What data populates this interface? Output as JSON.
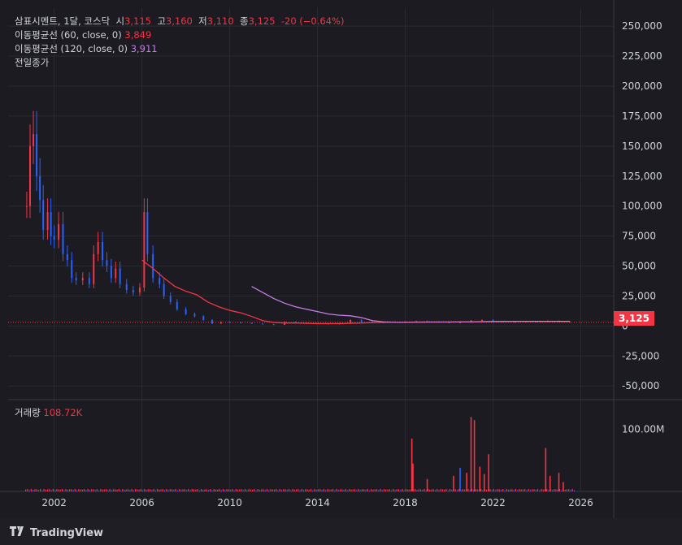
{
  "legend": {
    "symbol": "삼표시멘트, 1달, 코스닥",
    "open_label": "시",
    "open": "3,115",
    "high_label": "고",
    "high": "3,160",
    "low_label": "저",
    "low": "3,110",
    "close_label": "종",
    "close": "3,125",
    "change": "-20 (−0.64%)",
    "ma60_label": "이동평균선 (60, close, 0)",
    "ma60_value": "3,849",
    "ma120_label": "이동평균선 (120, close, 0)",
    "ma120_value": "3,911",
    "prev_close_label": "전일종가",
    "volume_label": "거래량",
    "volume_value": "108.72K"
  },
  "price_tag": "3,125",
  "footer": {
    "brand": "TradingView"
  },
  "colors": {
    "up": "#f23645",
    "down": "#2962ff",
    "ma60": "#f23645",
    "ma120": "#c77de6",
    "background": "#1b1b21",
    "grid": "#2a2a31"
  },
  "chart_data": {
    "type": "candlestick",
    "interval": "1 month",
    "y_ticks": [
      "250,000",
      "225,000",
      "200,000",
      "175,000",
      "150,000",
      "125,000",
      "100,000",
      "75,000",
      "50,000",
      "25,000",
      "0",
      "-25,000",
      "-50,000"
    ],
    "y_tick_values": [
      250000,
      225000,
      200000,
      175000,
      150000,
      125000,
      100000,
      75000,
      50000,
      25000,
      0,
      -25000,
      -50000
    ],
    "ylim": [
      -60000,
      265000
    ],
    "x_ticks": [
      "2002",
      "2006",
      "2010",
      "2014",
      "2018",
      "2022",
      "2026"
    ],
    "x_tick_values": [
      2002,
      2006,
      2010,
      2014,
      2018,
      2022,
      2026
    ],
    "xlim": [
      1999.9,
      2027.5
    ],
    "volume_ticks": [
      "100.00M"
    ],
    "volume_tick_values": [
      100000000
    ],
    "volume_max": 135000000,
    "last_price": 3125,
    "price_series": [
      [
        2000.75,
        100000
      ],
      [
        2000.9,
        150000
      ],
      [
        2001.05,
        160000
      ],
      [
        2001.2,
        125000
      ],
      [
        2001.35,
        105000
      ],
      [
        2001.5,
        80000
      ],
      [
        2001.7,
        95000
      ],
      [
        2001.85,
        75000
      ],
      [
        2002.0,
        72000
      ],
      [
        2002.2,
        85000
      ],
      [
        2002.4,
        60000
      ],
      [
        2002.6,
        55000
      ],
      [
        2002.8,
        40000
      ],
      [
        2003.0,
        38000
      ],
      [
        2003.3,
        40000
      ],
      [
        2003.6,
        35000
      ],
      [
        2003.8,
        60000
      ],
      [
        2004.0,
        70000
      ],
      [
        2004.2,
        55000
      ],
      [
        2004.4,
        50000
      ],
      [
        2004.6,
        40000
      ],
      [
        2004.8,
        48000
      ],
      [
        2005.0,
        35000
      ],
      [
        2005.3,
        30000
      ],
      [
        2005.6,
        28000
      ],
      [
        2005.9,
        32000
      ],
      [
        2006.1,
        95000
      ],
      [
        2006.25,
        60000
      ],
      [
        2006.5,
        40000
      ],
      [
        2006.8,
        35000
      ],
      [
        2007.0,
        25000
      ],
      [
        2007.3,
        20000
      ],
      [
        2007.6,
        14000
      ],
      [
        2008.0,
        10000
      ],
      [
        2008.4,
        8000
      ],
      [
        2008.8,
        5000
      ],
      [
        2009.2,
        2000
      ],
      [
        2009.6,
        3500
      ],
      [
        2010.0,
        3000
      ],
      [
        2010.5,
        2500
      ],
      [
        2011.0,
        2000
      ],
      [
        2011.5,
        1500
      ],
      [
        2012.0,
        1000
      ],
      [
        2012.5,
        3500
      ],
      [
        2013.0,
        2500
      ],
      [
        2013.5,
        2500
      ],
      [
        2014.0,
        2000
      ],
      [
        2014.5,
        1500
      ],
      [
        2015.0,
        2500
      ],
      [
        2015.5,
        5000
      ],
      [
        2016.0,
        3500
      ],
      [
        2016.5,
        3000
      ],
      [
        2017.0,
        3000
      ],
      [
        2017.5,
        3500
      ],
      [
        2018.0,
        3500
      ],
      [
        2018.5,
        4000
      ],
      [
        2019.0,
        3500
      ],
      [
        2019.5,
        3000
      ],
      [
        2020.0,
        2500
      ],
      [
        2020.5,
        3000
      ],
      [
        2021.0,
        4500
      ],
      [
        2021.5,
        5000
      ],
      [
        2022.0,
        4000
      ],
      [
        2022.5,
        3500
      ],
      [
        2023.0,
        3500
      ],
      [
        2023.5,
        3800
      ],
      [
        2024.0,
        3500
      ],
      [
        2024.5,
        4200
      ],
      [
        2025.0,
        3500
      ],
      [
        2025.5,
        3125
      ]
    ],
    "ma60": [
      [
        2006.0,
        55000
      ],
      [
        2006.5,
        48000
      ],
      [
        2007.0,
        40000
      ],
      [
        2007.5,
        33000
      ],
      [
        2008.0,
        29000
      ],
      [
        2008.5,
        26000
      ],
      [
        2009.0,
        20000
      ],
      [
        2009.5,
        16000
      ],
      [
        2010.0,
        13000
      ],
      [
        2010.5,
        11000
      ],
      [
        2011.0,
        8000
      ],
      [
        2011.5,
        4500
      ],
      [
        2012.0,
        3000
      ],
      [
        2012.5,
        2500
      ],
      [
        2013.0,
        2500
      ],
      [
        2014.0,
        2000
      ],
      [
        2015.0,
        2000
      ],
      [
        2016.0,
        2500
      ],
      [
        2017.0,
        3000
      ],
      [
        2018.0,
        3200
      ],
      [
        2019.0,
        3500
      ],
      [
        2020.0,
        3400
      ],
      [
        2021.0,
        3500
      ],
      [
        2022.0,
        3800
      ],
      [
        2023.0,
        3900
      ],
      [
        2024.0,
        3850
      ],
      [
        2025.0,
        3850
      ],
      [
        2025.5,
        3849
      ]
    ],
    "ma120": [
      [
        2011.0,
        33000
      ],
      [
        2011.5,
        28000
      ],
      [
        2012.0,
        23000
      ],
      [
        2012.5,
        19000
      ],
      [
        2013.0,
        16000
      ],
      [
        2013.5,
        14000
      ],
      [
        2014.0,
        12000
      ],
      [
        2014.5,
        10000
      ],
      [
        2015.0,
        9000
      ],
      [
        2015.5,
        8500
      ],
      [
        2016.0,
        7000
      ],
      [
        2016.5,
        4500
      ],
      [
        2017.0,
        3500
      ],
      [
        2017.5,
        3200
      ],
      [
        2018.0,
        3100
      ],
      [
        2019.0,
        3200
      ],
      [
        2020.0,
        3300
      ],
      [
        2021.0,
        3500
      ],
      [
        2022.0,
        3700
      ],
      [
        2023.0,
        3800
      ],
      [
        2024.0,
        3900
      ],
      [
        2025.0,
        3910
      ],
      [
        2025.5,
        3911
      ]
    ],
    "volume_spikes": [
      [
        2018.3,
        85000000,
        "up"
      ],
      [
        2018.35,
        45000000,
        "up"
      ],
      [
        2019.0,
        20000000,
        "up"
      ],
      [
        2020.2,
        25000000,
        "up"
      ],
      [
        2020.5,
        38000000,
        "down"
      ],
      [
        2020.8,
        30000000,
        "up"
      ],
      [
        2021.0,
        120000000,
        "up"
      ],
      [
        2021.15,
        115000000,
        "up"
      ],
      [
        2021.4,
        40000000,
        "up"
      ],
      [
        2021.6,
        28000000,
        "up"
      ],
      [
        2021.8,
        60000000,
        "up"
      ],
      [
        2024.4,
        70000000,
        "up"
      ],
      [
        2024.6,
        25000000,
        "up"
      ],
      [
        2025.0,
        30000000,
        "up"
      ],
      [
        2025.2,
        15000000,
        "up"
      ]
    ]
  }
}
